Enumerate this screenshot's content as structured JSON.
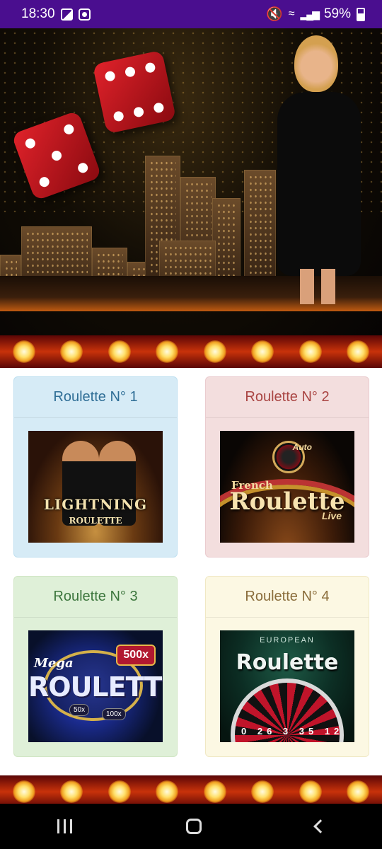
{
  "status_bar": {
    "time": "18:30",
    "left_icons": [
      "image-icon",
      "record-icon"
    ],
    "right_icons": [
      "mute-icon",
      "wifi-icon",
      "signal-icon"
    ],
    "battery": "59%"
  },
  "hero": {
    "icons": [
      "dice-icon",
      "dice-icon"
    ]
  },
  "cards": [
    {
      "label": "Roulette N° 1",
      "accent": "#2f6e96",
      "bg": "#d6ebf6",
      "thumb": {
        "title": "LIGHTNING",
        "subtitle": "ROULETTE"
      }
    },
    {
      "label": "Roulette N° 2",
      "accent": "#a94442",
      "bg": "#f3dede",
      "thumb": {
        "top": "Auto",
        "line1": "French",
        "title": "Roulette",
        "line2": "Live"
      }
    },
    {
      "label": "Roulette N° 3",
      "accent": "#3c763d",
      "bg": "#dff0d8",
      "thumb": {
        "line1": "Mega",
        "title": "ROULETTE",
        "badge": "500x",
        "chip1": "50x",
        "chip2": "100x"
      }
    },
    {
      "label": "Roulette N° 4",
      "accent": "#8a6d3b",
      "bg": "#fcf8e3",
      "thumb": {
        "line1": "EUROPEAN",
        "title": "Roulette",
        "numbers": "0 26 3 35 12"
      }
    }
  ],
  "navbar": {
    "recent_label": "recent-apps-icon",
    "home_label": "home-icon",
    "back_label": "back-icon"
  }
}
